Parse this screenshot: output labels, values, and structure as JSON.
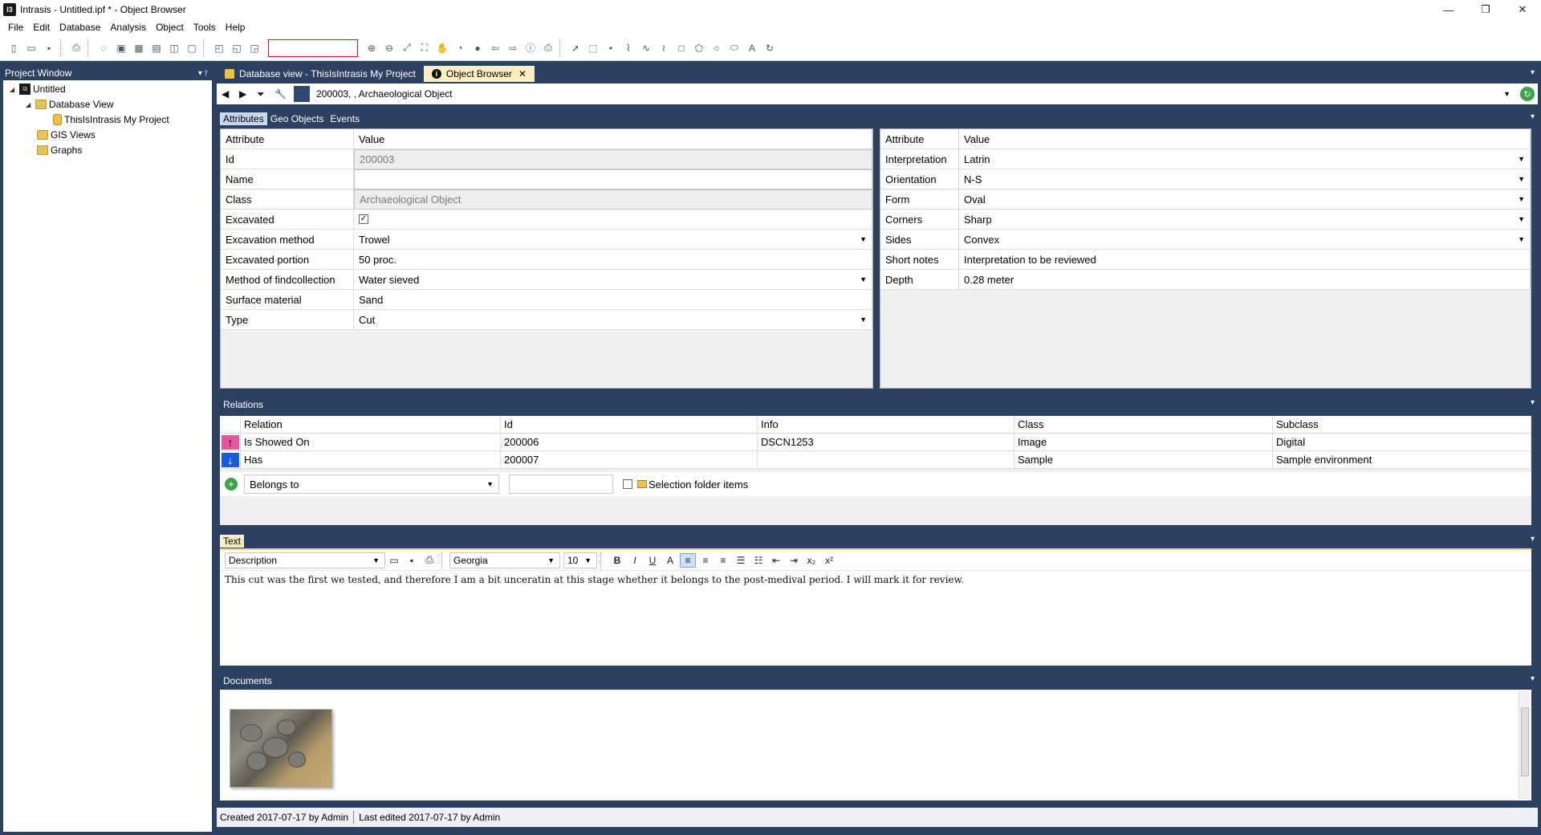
{
  "window": {
    "title": "Intrasis - Untitled.ipf * - Object Browser",
    "controls": [
      "—",
      "❐",
      "✕"
    ]
  },
  "menu": [
    "File",
    "Edit",
    "Database",
    "Analysis",
    "Object",
    "Tools",
    "Help"
  ],
  "toolbar": {
    "search_value": ""
  },
  "project": {
    "header": "Project Window",
    "tree": [
      {
        "label": "Untitled"
      },
      {
        "label": "Database View"
      },
      {
        "label": "ThisIsIntrasis My Project"
      },
      {
        "label": "GIS Views"
      },
      {
        "label": "Graphs"
      }
    ]
  },
  "tabs": [
    {
      "label": "Database view - ThisIsIntrasis My Project"
    },
    {
      "label": "Object Browser"
    }
  ],
  "nav": {
    "object": "200003, , Archaeological Object"
  },
  "subtabs": [
    "Attributes",
    "Geo Objects",
    "Events"
  ],
  "attributes_left": {
    "headers": [
      "Attribute",
      "Value"
    ],
    "rows": [
      {
        "attr": "Id",
        "value": "200003"
      },
      {
        "attr": "Name",
        "value": ""
      },
      {
        "attr": "Class",
        "value": "Archaeological Object"
      },
      {
        "attr": "Excavated",
        "value": "✓"
      },
      {
        "attr": "Excavation method",
        "value": "Trowel"
      },
      {
        "attr": "Excavated portion",
        "value": "50 proc."
      },
      {
        "attr": "Method of findcollection",
        "value": "Water sieved"
      },
      {
        "attr": "Surface material",
        "value": "Sand"
      },
      {
        "attr": "Type",
        "value": "Cut"
      }
    ]
  },
  "attributes_right": {
    "headers": [
      "Attribute",
      "Value"
    ],
    "rows": [
      {
        "attr": "Interpretation",
        "value": "Latrin"
      },
      {
        "attr": "Orientation",
        "value": "N-S"
      },
      {
        "attr": "Form",
        "value": "Oval"
      },
      {
        "attr": "Corners",
        "value": "Sharp"
      },
      {
        "attr": "Sides",
        "value": "Convex"
      },
      {
        "attr": "Short notes",
        "value": "Interpretation to be reviewed"
      },
      {
        "attr": "Depth",
        "value": "0.28 meter"
      }
    ]
  },
  "relations": {
    "label": "Relations",
    "headers": [
      "Relation",
      "Id",
      "Info",
      "Class",
      "Subclass"
    ],
    "rows": [
      {
        "relation": "Is Showed On",
        "id": "200006",
        "info": "DSCN1253",
        "class": "Image",
        "subclass": "Digital"
      },
      {
        "relation": "Has",
        "id": "200007",
        "info": "",
        "class": "Sample",
        "subclass": "Sample environment"
      }
    ],
    "add_relation": "Belongs to",
    "selection_label": "Selection folder items"
  },
  "text": {
    "label": "Text",
    "style": "Description",
    "font": "Georgia",
    "size": "10",
    "body": "This cut was the first we tested, and therefore I am a bit unceratin at this stage whether it belongs to the post-medival period. I will mark it for review."
  },
  "documents": {
    "label": "Documents"
  },
  "status": {
    "created": "Created 2017-07-17 by Admin",
    "edited": "Last edited 2017-07-17 by Admin"
  }
}
